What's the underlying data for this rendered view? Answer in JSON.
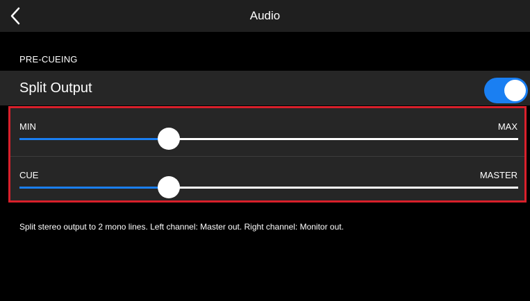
{
  "navbar": {
    "title": "Audio",
    "back_icon": "chevron-left-icon"
  },
  "section": {
    "header": "PRE-CUEING"
  },
  "split_output": {
    "label": "Split Output",
    "enabled": true,
    "accent_color": "#1a7ff2"
  },
  "sliders": [
    {
      "min_label": "MIN",
      "max_label": "MAX",
      "value_fraction": 0.3
    },
    {
      "min_label": "CUE",
      "max_label": "MASTER",
      "value_fraction": 0.3
    }
  ],
  "description": "Split stereo output to 2 mono lines. Left channel: Master out. Right channel: Monitor out.",
  "colors": {
    "background": "#000000",
    "panel": "#262626",
    "navbar": "#1f1f1f",
    "highlight_border": "#d9202b"
  }
}
